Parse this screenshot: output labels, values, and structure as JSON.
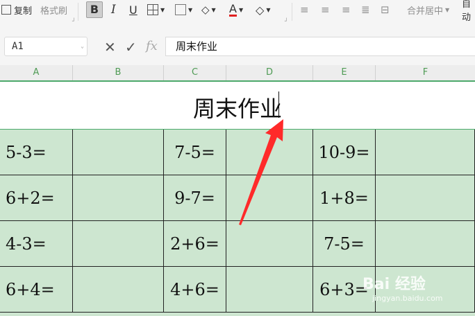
{
  "toolbar": {
    "copy_label": "复制",
    "format_painter_label": "格式刷",
    "merge_center_label": "合并居中",
    "auto_wrap_label": "自动"
  },
  "formula_bar": {
    "name_box": "A1",
    "fx_label": "fx",
    "content": "周末作业"
  },
  "columns": [
    "A",
    "B",
    "C",
    "D",
    "E",
    "F"
  ],
  "sheet": {
    "title": "周末作业",
    "rows": [
      [
        "5-3=",
        "",
        "7-5=",
        "",
        "10-9=",
        ""
      ],
      [
        "6+2=",
        "",
        "9-7=",
        "",
        "1+8=",
        ""
      ],
      [
        "4-3=",
        "",
        "2+6=",
        "",
        "7-5=",
        ""
      ],
      [
        "6+4=",
        "",
        "4+6=",
        "",
        "6+3=",
        ""
      ]
    ]
  },
  "colors": {
    "cell_fill": "#cde6d0",
    "header_accent": "#4ca96b",
    "arrow": "#ff2a2a"
  },
  "watermark": {
    "text": "Bai 经验",
    "sub": "jingyan.baidu.com"
  }
}
